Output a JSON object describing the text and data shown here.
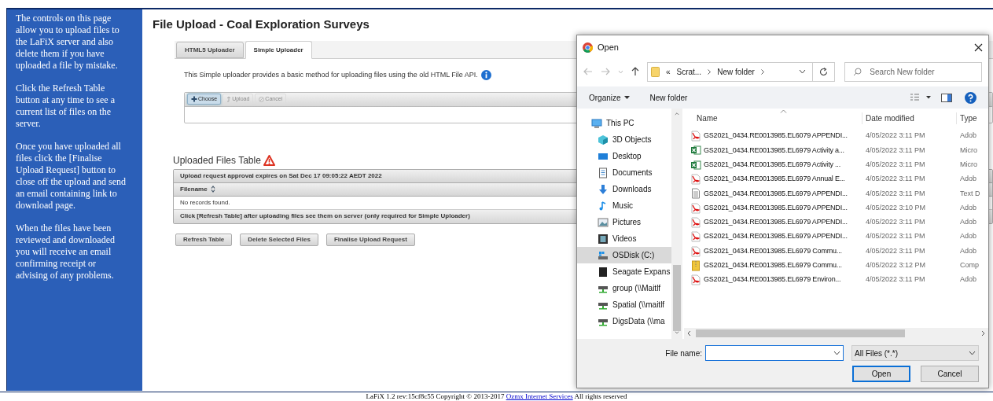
{
  "sidebar": {
    "paragraphs": [
      "The controls on this page allow you to upload files to the LaFiX server and also delete them if you have uploaded a file by mistake.",
      "Click the Refresh Table button at any time to see a current list of files on the server.",
      "Once you have uploaded all files click the [Finalise Upload Request] button to close off the upload and send an email containing link to download page.",
      "When the files have been reviewed and downloaded you will receive an email confirming receipt or advising of any problems."
    ]
  },
  "page_title": "File Upload - Coal Exploration Surveys",
  "tabs": [
    {
      "label": "HTML5 Uploader",
      "selected": false
    },
    {
      "label": "Simple Uploader",
      "selected": true
    }
  ],
  "uploader": {
    "description": "This Simple uploader provides a basic method for uploading files using the old HTML File API.",
    "buttons": [
      {
        "label": "Choose",
        "kind": "choose",
        "disabled": false
      },
      {
        "label": "Upload",
        "kind": "upload",
        "disabled": true
      },
      {
        "label": "Cancel",
        "kind": "cancel",
        "disabled": true
      }
    ]
  },
  "table": {
    "heading": "Uploaded Files Table",
    "caption": "Upload request approval expires on Sat Dec 17 09:05:22 AEDT 2022",
    "columns": [
      "Filename"
    ],
    "empty_message": "No records found.",
    "footer": "Click [Refresh Table] after uploading files see them on server (only required for Simple Uploader)"
  },
  "actions": [
    "Refresh Table",
    "Delete Selected Files",
    "Finalise Upload Request"
  ],
  "footer": {
    "text": "LaFiX 1.2 rev:15cf8c55 Copyright © 2013-2017",
    "link": "Ozmx Internet Services",
    "after": "All rights reserved"
  },
  "dialog": {
    "title": "Open",
    "breadcrumb": [
      "«",
      "Scrat...",
      "New folder"
    ],
    "search_placeholder": "Search New folder",
    "toolbar": [
      "Organize",
      "New folder"
    ],
    "nav": [
      {
        "label": "This PC",
        "kind": "pc",
        "selected": false
      },
      {
        "label": "3D Objects",
        "kind": "cube",
        "selected": false
      },
      {
        "label": "Desktop",
        "kind": "desktop",
        "selected": false
      },
      {
        "label": "Documents",
        "kind": "docs",
        "selected": false
      },
      {
        "label": "Downloads",
        "kind": "down",
        "selected": false
      },
      {
        "label": "Music",
        "kind": "music",
        "selected": false
      },
      {
        "label": "Pictures",
        "kind": "pictures",
        "selected": false
      },
      {
        "label": "Videos",
        "kind": "videos",
        "selected": false
      },
      {
        "label": "OSDisk (C:)",
        "kind": "disk",
        "selected": true
      },
      {
        "label": "Seagate Expans",
        "kind": "drive",
        "selected": false
      },
      {
        "label": "group (\\\\Maitlf",
        "kind": "net",
        "selected": false
      },
      {
        "label": "Spatial (\\\\maitlf",
        "kind": "net",
        "selected": false
      },
      {
        "label": "DigsData (\\\\ma",
        "kind": "net",
        "selected": false
      }
    ],
    "columns": [
      "Name",
      "Date modified",
      "Type"
    ],
    "files": [
      {
        "name": "GS2021_0434.RE0013985.EL6079 APPENDI...",
        "date": "4/05/2022 3:11 PM",
        "type": "Adob",
        "kind": "pdf"
      },
      {
        "name": "GS2021_0434.RE0013985.EL6979 Activity a...",
        "date": "4/05/2022 3:11 PM",
        "type": "Micro",
        "kind": "excel"
      },
      {
        "name": "GS2021_0434.RE0013985.EL6979 Activity ...",
        "date": "4/05/2022 3:11 PM",
        "type": "Micro",
        "kind": "excel"
      },
      {
        "name": "GS2021_0434.RE0013985.EL6979 Annual E...",
        "date": "4/05/2022 3:11 PM",
        "type": "Adob",
        "kind": "pdf"
      },
      {
        "name": "GS2021_0434.RE0013985.EL6979 APPENDI...",
        "date": "4/05/2022 3:11 PM",
        "type": "Text D",
        "kind": "text"
      },
      {
        "name": "GS2021_0434.RE0013985.EL6979 APPENDI...",
        "date": "4/05/2022 3:10 PM",
        "type": "Adob",
        "kind": "pdf"
      },
      {
        "name": "GS2021_0434.RE0013985.EL6979 APPENDI...",
        "date": "4/05/2022 3:11 PM",
        "type": "Adob",
        "kind": "pdf"
      },
      {
        "name": "GS2021_0434.RE0013985.EL6979 APPENDI...",
        "date": "4/05/2022 3:11 PM",
        "type": "Adob",
        "kind": "pdf"
      },
      {
        "name": "GS2021_0434.RE0013985.EL6979 Commu...",
        "date": "4/05/2022 3:11 PM",
        "type": "Adob",
        "kind": "pdf"
      },
      {
        "name": "GS2021_0434.RE0013985.EL6979 Commu...",
        "date": "4/05/2022 3:12 PM",
        "type": "Comp",
        "kind": "zip"
      },
      {
        "name": "GS2021_0434.RE0013985.EL6979 Environ...",
        "date": "4/05/2022 3:11 PM",
        "type": "Adob",
        "kind": "pdf"
      }
    ],
    "file_name_label": "File name:",
    "filter": "All Files (*.*)",
    "buttons": [
      {
        "label": "Open",
        "kind": "primary"
      },
      {
        "label": "Cancel",
        "kind": "secondary"
      }
    ]
  }
}
